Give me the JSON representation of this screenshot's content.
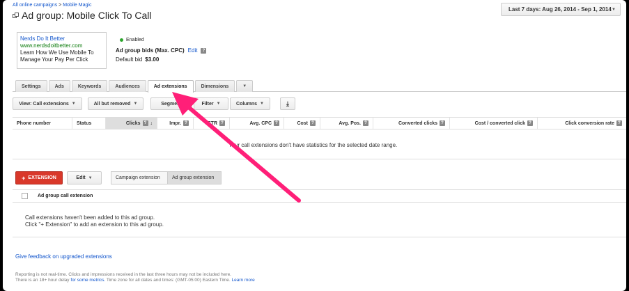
{
  "breadcrumb": {
    "root": "All online campaigns",
    "sep": ">",
    "campaign": "Mobile Magic"
  },
  "header": {
    "title": "Ad group: Mobile Click To Call",
    "date_range": "Last 7 days: Aug 26, 2014 - Sep 1, 2014"
  },
  "ad_preview": {
    "headline": "Nerds Do It Better",
    "display_url": "www.nerdsdoitbetter.com",
    "line1": "Learn How We Use Mobile To",
    "line2": "Manage Your Pay Per Click"
  },
  "status": {
    "label": "Enabled",
    "color": "#2ba52b"
  },
  "bids": {
    "label": "Ad group bids (Max. CPC)",
    "edit": "Edit",
    "default_label": "Default bid",
    "default_value": "$3.00"
  },
  "tabs": [
    "Settings",
    "Ads",
    "Keywords",
    "Audiences",
    "Ad extensions",
    "Dimensions"
  ],
  "active_tab": "Ad extensions",
  "toolbar": {
    "view": "View: Call extensions",
    "filter_removed": "All but removed",
    "segment": "Segment",
    "filter": "Filter",
    "columns": "Columns"
  },
  "table": {
    "columns": [
      "Phone number",
      "Status",
      "Clicks",
      "Impr.",
      "CTR",
      "Avg. CPC",
      "Cost",
      "Avg. Pos.",
      "Converted clicks",
      "Cost / converted click",
      "Click conversion rate"
    ],
    "empty_message": "Your call extensions don't have statistics for the selected date range."
  },
  "extension_section": {
    "add_button": "EXTENSION",
    "edit_button": "Edit",
    "segments": [
      "Campaign extension",
      "Ad group extension"
    ],
    "column": "Ad group call extension",
    "empty_line1": "Call extensions haven't been added to this ad group.",
    "empty_line2": "Click \"+ Extension\" to add an extension to this ad group."
  },
  "feedback_link": "Give feedback on upgraded extensions",
  "footer": {
    "line1": "Reporting is not real-time. Clicks and impressions received in the last three hours may not be included here.",
    "line2_a": "There is an 18+ hour delay",
    "line2_link": "for some metrics.",
    "line2_b": "Time zone for all dates and times: (GMT-05:00) Eastern Time.",
    "line2_more": "Learn more"
  },
  "colors": {
    "accent": "#15c",
    "arrow": "#ff1f78",
    "extension_button": "#d9382a"
  }
}
